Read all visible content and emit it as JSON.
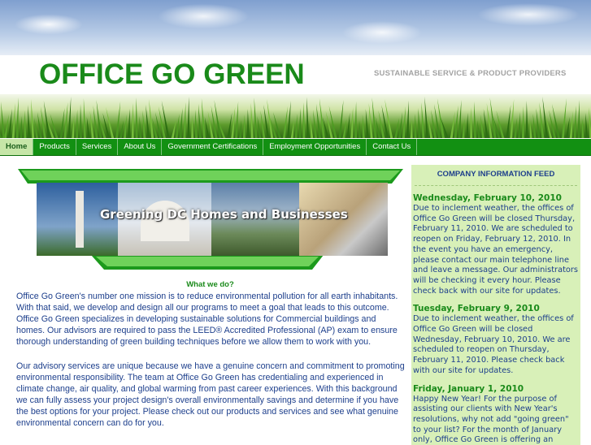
{
  "site": {
    "title": "OFFICE GO GREEN",
    "tagline": "SUSTAINABLE SERVICE & PRODUCT PROVIDERS"
  },
  "nav": {
    "items": [
      {
        "label": "Home",
        "active": true
      },
      {
        "label": "Products"
      },
      {
        "label": "Services"
      },
      {
        "label": "About Us"
      },
      {
        "label": "Government Certifications"
      },
      {
        "label": "Employment Opportunities"
      },
      {
        "label": "Contact Us"
      }
    ]
  },
  "banner": {
    "caption": "Greening DC Homes and Businesses"
  },
  "main": {
    "heading": "What we do?",
    "paragraphs": [
      "Office Go Green's number one mission is to reduce environmental pollution for all earth inhabitants. With that said, we develop and design all our programs to meet a goal that leads to this outcome. Office Go Green specializes in developing sustainable solutions for Commercial buildings and homes. Our advisors are required to pass the LEED® Accredited Professional (AP) exam to ensure thorough understanding of green building techniques before we allow them to work with you.",
      "Our advisory services are unique because we have a genuine concern and commitment to promoting environmental responsibility. The team at Office Go Green has credentialing and experienced in climate change, air quality, and global warming from past career experiences. With this background we can fully assess your project design's overall environmentally savings and determine if you have the best options for your project. Please check out our products and services and see what genuine environmental concern can do for you."
    ]
  },
  "feed": {
    "title": "COMPANY INFORMATION FEED",
    "entries": [
      {
        "date": "Wednesday, February 10, 2010",
        "text": "Due to inclement weather, the offices of Office Go Green will be closed Thursday, February 11, 2010.  We are scheduled to reopen on Friday, February 12, 2010.  In the event you have an emergency, please contact our main telephone line and leave a message.  Our administrators will be checking it every hour.  Please check back with our site for updates."
      },
      {
        "date": "Tuesday, February 9, 2010",
        "text": "Due to inclement weather, the offices of Office Go Green will be closed Wednesday, February 10, 2010.  We are scheduled to reopen on Thursday, February 11, 2010.  Please check back with our site for updates."
      },
      {
        "date": "Friday, January 1, 2010",
        "text": "Happy New Year!  For the purpose of assisting our clients with New Year's resolutions, why not  add \"going green\" to your list?  For the month of January only, Office Go Green is offering an unbeatable recycling promotion.  Please click on the"
      }
    ]
  },
  "colors": {
    "brand_green": "#1a8a1a",
    "nav_green": "#129012",
    "text_blue": "#1d3f8c",
    "feed_bg": "#d8f0b8"
  }
}
